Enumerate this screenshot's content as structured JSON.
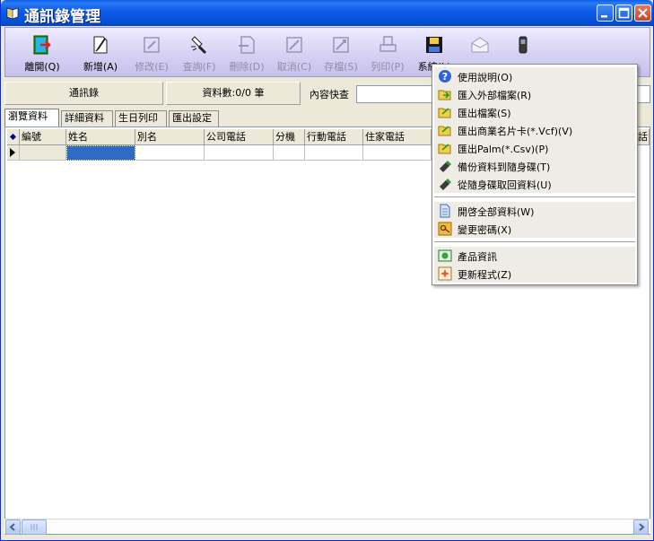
{
  "window": {
    "title": "通訊錄管理"
  },
  "toolbar": {
    "items": [
      {
        "label": "離開(Q)",
        "enabled": true
      },
      {
        "label": "新增(A)",
        "enabled": true
      },
      {
        "label": "修改(E)",
        "enabled": false
      },
      {
        "label": "查詢(F)",
        "enabled": false
      },
      {
        "label": "刪除(D)",
        "enabled": false
      },
      {
        "label": "取消(C)",
        "enabled": false
      },
      {
        "label": "存檔(S)",
        "enabled": false
      },
      {
        "label": "列印(P)",
        "enabled": false
      },
      {
        "label": "系統(L)",
        "enabled": true
      },
      {
        "label": "",
        "enabled": false
      },
      {
        "label": "",
        "enabled": false
      }
    ]
  },
  "infobar": {
    "book_label": "通訊錄",
    "record_count": "資料數:0/0 筆",
    "search_label": "內容快查",
    "search_value": ""
  },
  "tabs": [
    {
      "label": "瀏覽資料",
      "active": true
    },
    {
      "label": "詳細資料",
      "active": false
    },
    {
      "label": "生日列印",
      "active": false
    },
    {
      "label": "匯出設定",
      "active": false
    }
  ],
  "grid": {
    "columns": [
      "編號",
      "姓名",
      "別名",
      "公司電話",
      "分機",
      "行動電話",
      "住家電話"
    ],
    "right_header_fragment": "話"
  },
  "menu": {
    "groups": [
      [
        {
          "label": "使用說明(O)",
          "icon": "help-icon"
        },
        {
          "label": "匯入外部檔案(R)",
          "icon": "folder-import-icon"
        },
        {
          "label": "匯出檔案(S)",
          "icon": "folder-export-icon"
        },
        {
          "label": "匯出商業名片卡(*.Vcf)(V)",
          "icon": "folder-export-icon"
        },
        {
          "label": "匯出Palm(*.Csv)(P)",
          "icon": "folder-export-icon"
        },
        {
          "label": "備份資料到隨身碟(T)",
          "icon": "usb-drive-icon"
        },
        {
          "label": "從隨身碟取回資料(U)",
          "icon": "usb-drive-icon"
        }
      ],
      [
        {
          "label": "開啓全部資料(W)",
          "icon": "document-icon"
        },
        {
          "label": "變更密碼(X)",
          "icon": "key-icon"
        }
      ],
      [
        {
          "label": "產品資訊",
          "icon": "info-icon"
        },
        {
          "label": "更新程式(Z)",
          "icon": "update-icon"
        }
      ]
    ]
  },
  "colors": {
    "titlebar": "#0553db",
    "toolbar": "#d8d4f4",
    "selection": "#316ac5"
  }
}
